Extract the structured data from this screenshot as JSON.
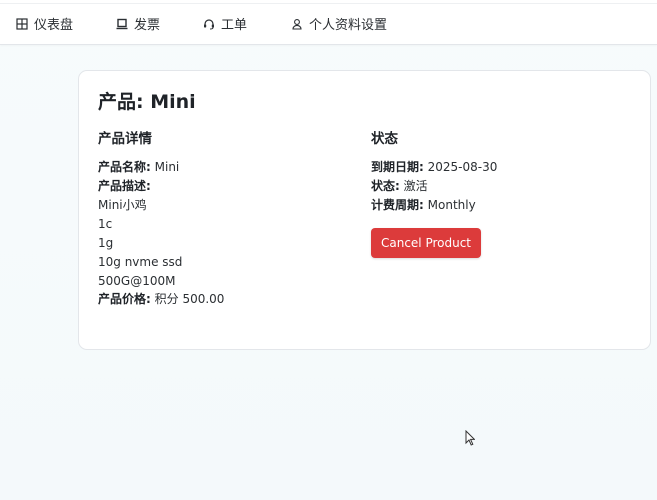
{
  "nav": {
    "items": [
      {
        "label": "仪表盘",
        "icon": "grid-icon"
      },
      {
        "label": "发票",
        "icon": "laptop-icon"
      },
      {
        "label": "工单",
        "icon": "headset-icon"
      },
      {
        "label": "个人资料设置",
        "icon": "user-icon"
      }
    ]
  },
  "product": {
    "title": "产品: Mini",
    "details": {
      "heading": "产品详情",
      "name_label": "产品名称:",
      "name_value": "Mini",
      "desc_label": "产品描述:",
      "desc_lines": [
        "Mini小鸡",
        "1c",
        "1g",
        "10g nvme ssd",
        "500G@100M"
      ],
      "price_label": "产品价格:",
      "price_value": "积分 500.00"
    },
    "status": {
      "heading": "状态",
      "expiry_label": "到期日期:",
      "expiry_value": "2025-08-30",
      "state_label": "状态:",
      "state_value": "激活",
      "cycle_label": "计费周期:",
      "cycle_value": "Monthly"
    },
    "cancel_label": "Cancel Product"
  },
  "colors": {
    "danger": "#dc3b3b",
    "background": "#f5fafb",
    "card_border": "#e3e6ea"
  }
}
